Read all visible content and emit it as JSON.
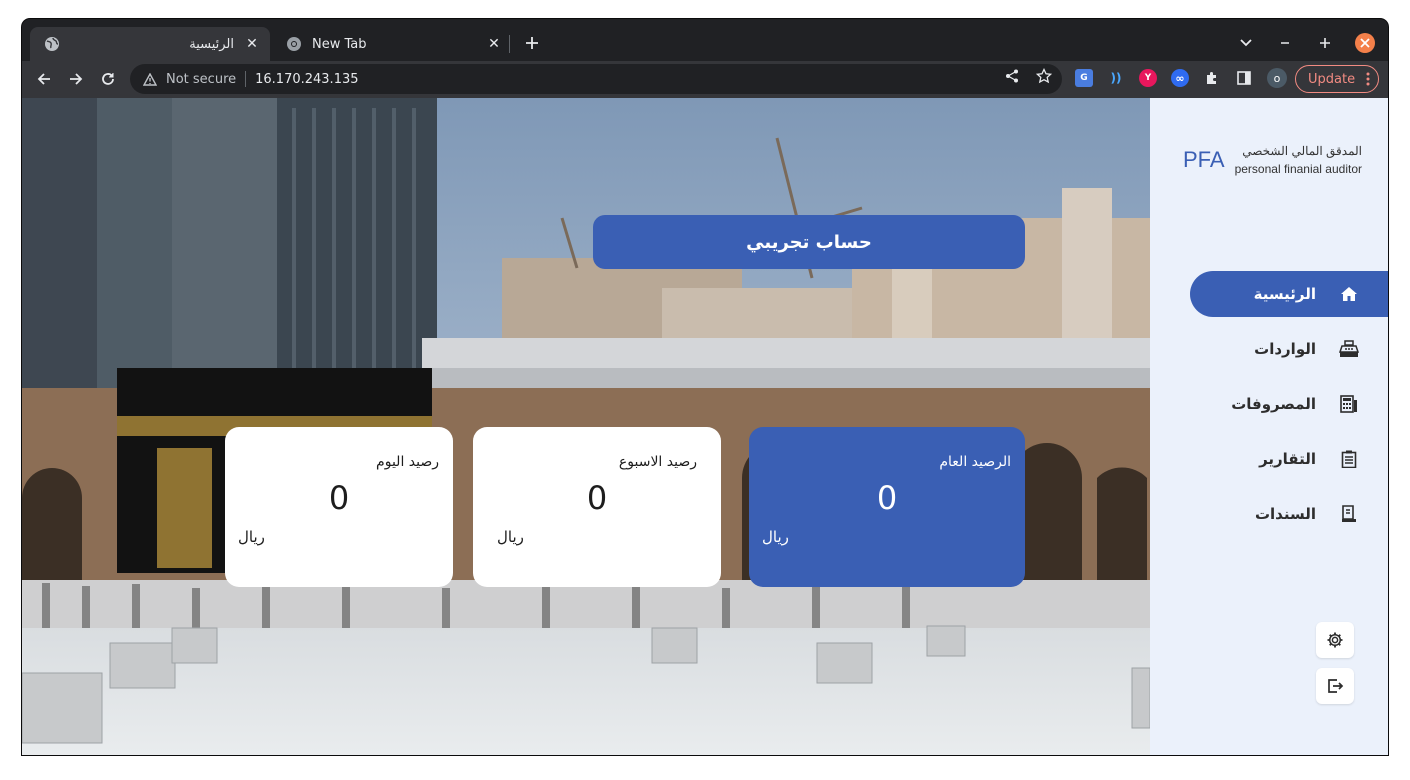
{
  "browser": {
    "tabs": [
      {
        "title": "الرئيسية",
        "favicon": "globe-icon",
        "active": true
      },
      {
        "title": "New Tab",
        "favicon": "chrome-icon",
        "active": false
      }
    ],
    "address": {
      "security_label": "Not secure",
      "url": "16.170.243.135"
    },
    "update_label": "Update",
    "profile_initial": "o",
    "extensions": [
      "google-translate-icon",
      "wifi-extension-icon",
      "red-extension-icon",
      "infinity-extension-icon",
      "puzzle-icon",
      "sidepanel-icon"
    ]
  },
  "app": {
    "brand": {
      "logo": "PFA",
      "title_ar": "المدقق المالي الشخصي",
      "title_en": "personal finanial auditor"
    },
    "nav": [
      {
        "label": "الرئيسية",
        "icon": "home-icon",
        "active": true
      },
      {
        "label": "الواردات",
        "icon": "cash-register-icon",
        "active": false
      },
      {
        "label": "المصروفات",
        "icon": "calculator-icon",
        "active": false
      },
      {
        "label": "التقارير",
        "icon": "clipboard-icon",
        "active": false
      },
      {
        "label": "السندات",
        "icon": "receipt-icon",
        "active": false
      }
    ],
    "account_banner": "حساب تجريبي",
    "cards": [
      {
        "title": "الرصيد العام",
        "value": "0",
        "unit": "ريال",
        "primary": true
      },
      {
        "title": "رصيد الاسبوع",
        "value": "0",
        "unit": "ريال",
        "primary": false
      },
      {
        "title": "رصيد اليوم",
        "value": "0",
        "unit": "ريال",
        "primary": false
      }
    ],
    "colors": {
      "accent": "#3a5fb4",
      "sidebar_bg": "#ebf1fb"
    }
  }
}
